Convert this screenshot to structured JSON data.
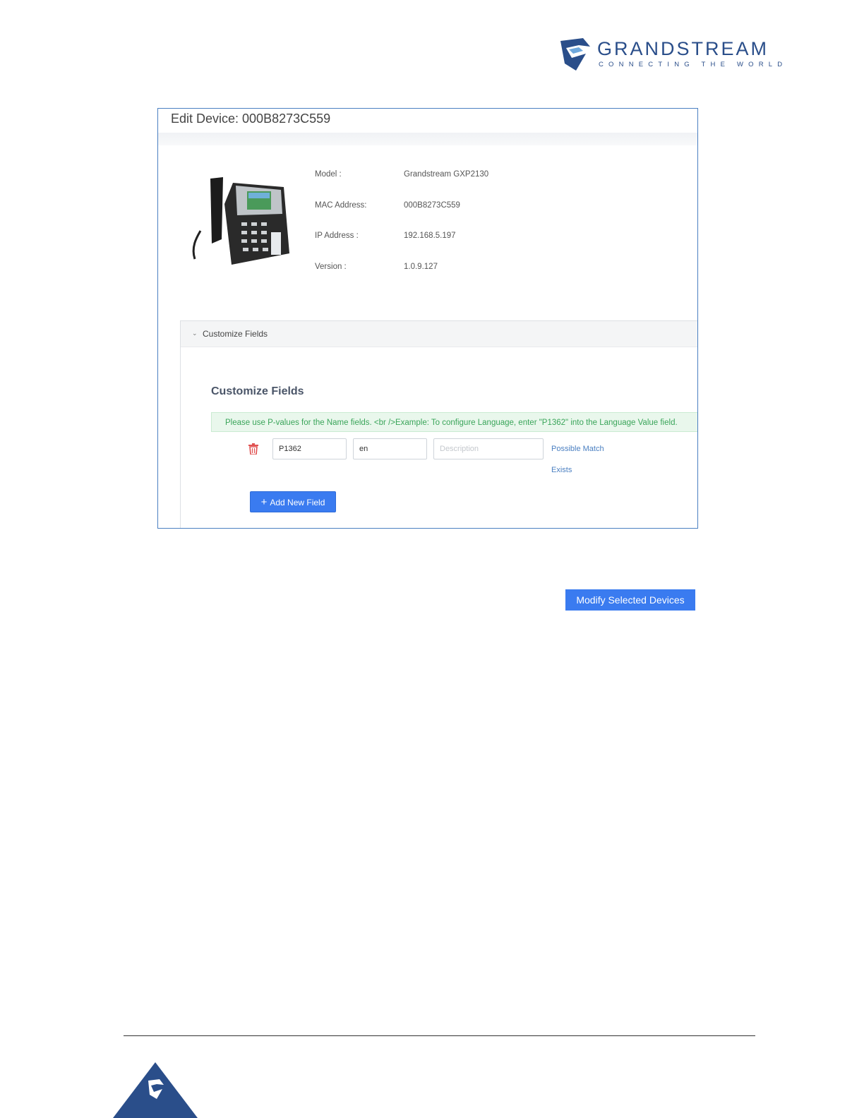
{
  "brand": {
    "name": "GRANDSTREAM",
    "tagline": "CONNECTING THE WORLD",
    "color": "#2a4e8a"
  },
  "dialog": {
    "title": "Edit Device: 000B8273C559",
    "device_info": [
      {
        "label": "Model :",
        "value": "Grandstream GXP2130"
      },
      {
        "label": "MAC Address:",
        "value": "000B8273C559"
      },
      {
        "label": "IP Address :",
        "value": "192.168.5.197"
      },
      {
        "label": "Version :",
        "value": "1.0.9.127"
      }
    ],
    "panel": {
      "header": "Customize Fields",
      "section_title": "Customize Fields",
      "hint": "Please use P-values for the Name fields. <br />Example: To configure Language, enter \"P1362\" into the Language Value field.",
      "row": {
        "name_value": "P1362",
        "value_value": "en",
        "description_placeholder": "Description",
        "possible_match": "Possible Match",
        "exists": "Exists"
      },
      "add_button": "Add New Field"
    }
  },
  "modify_button": "Modify Selected Devices",
  "colors": {
    "accent": "#3a7bf0",
    "frame_border": "#4a7fc1",
    "hint_text": "#3aa55a",
    "trash": "#e05252"
  }
}
